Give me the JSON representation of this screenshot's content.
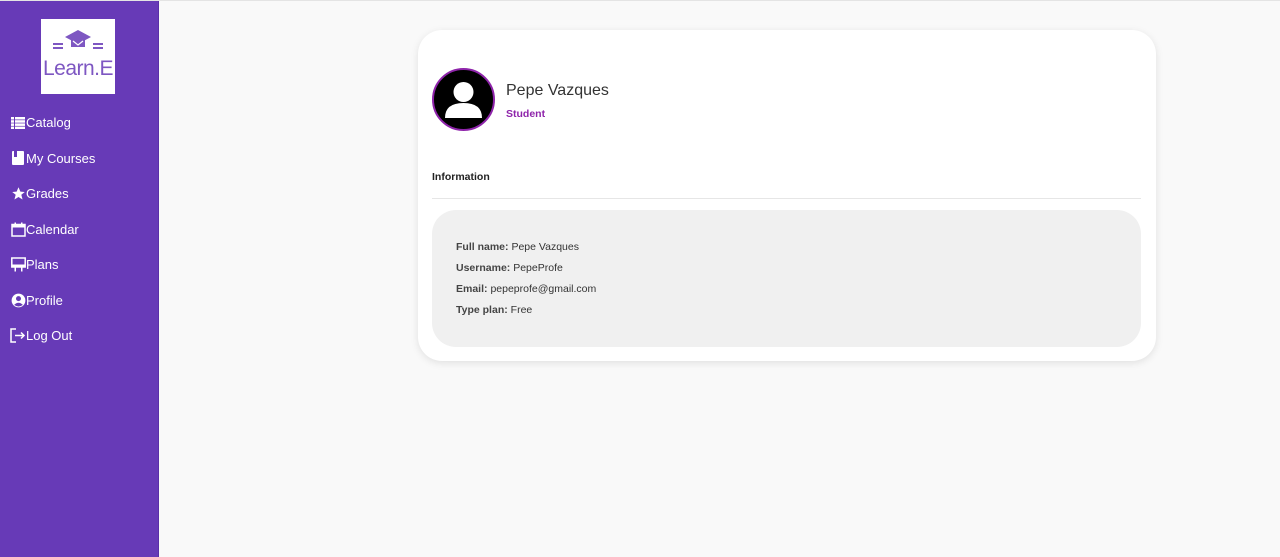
{
  "app": {
    "logo_text": "Learn.E",
    "logo_icon": "graduation-cap-icon"
  },
  "sidebar": {
    "items": [
      {
        "label": "Catalog",
        "icon": "list-icon"
      },
      {
        "label": "My Courses",
        "icon": "book-icon"
      },
      {
        "label": "Grades",
        "icon": "star-icon"
      },
      {
        "label": "Calendar",
        "icon": "calendar-icon"
      },
      {
        "label": "Plans",
        "icon": "presentation-board-icon"
      },
      {
        "label": "Profile",
        "icon": "user-circle-icon"
      },
      {
        "label": "Log Out",
        "icon": "logout-icon"
      }
    ]
  },
  "profile": {
    "name": "Pepe Vazques",
    "role": "Student",
    "section_title": "Information",
    "fields": [
      {
        "key": "Full name:",
        "value": "Pepe Vazques"
      },
      {
        "key": "Username:",
        "value": "PepeProfe"
      },
      {
        "key": "Email:",
        "value": "pepeprofe@gmail.com"
      },
      {
        "key": "Type plan:",
        "value": "Free"
      }
    ]
  },
  "colors": {
    "sidebar": "#673ab7",
    "accent": "#8e24aa",
    "page_background": "#f9f9f9",
    "card_background": "#ffffff",
    "info_background": "#f0f0f0"
  }
}
